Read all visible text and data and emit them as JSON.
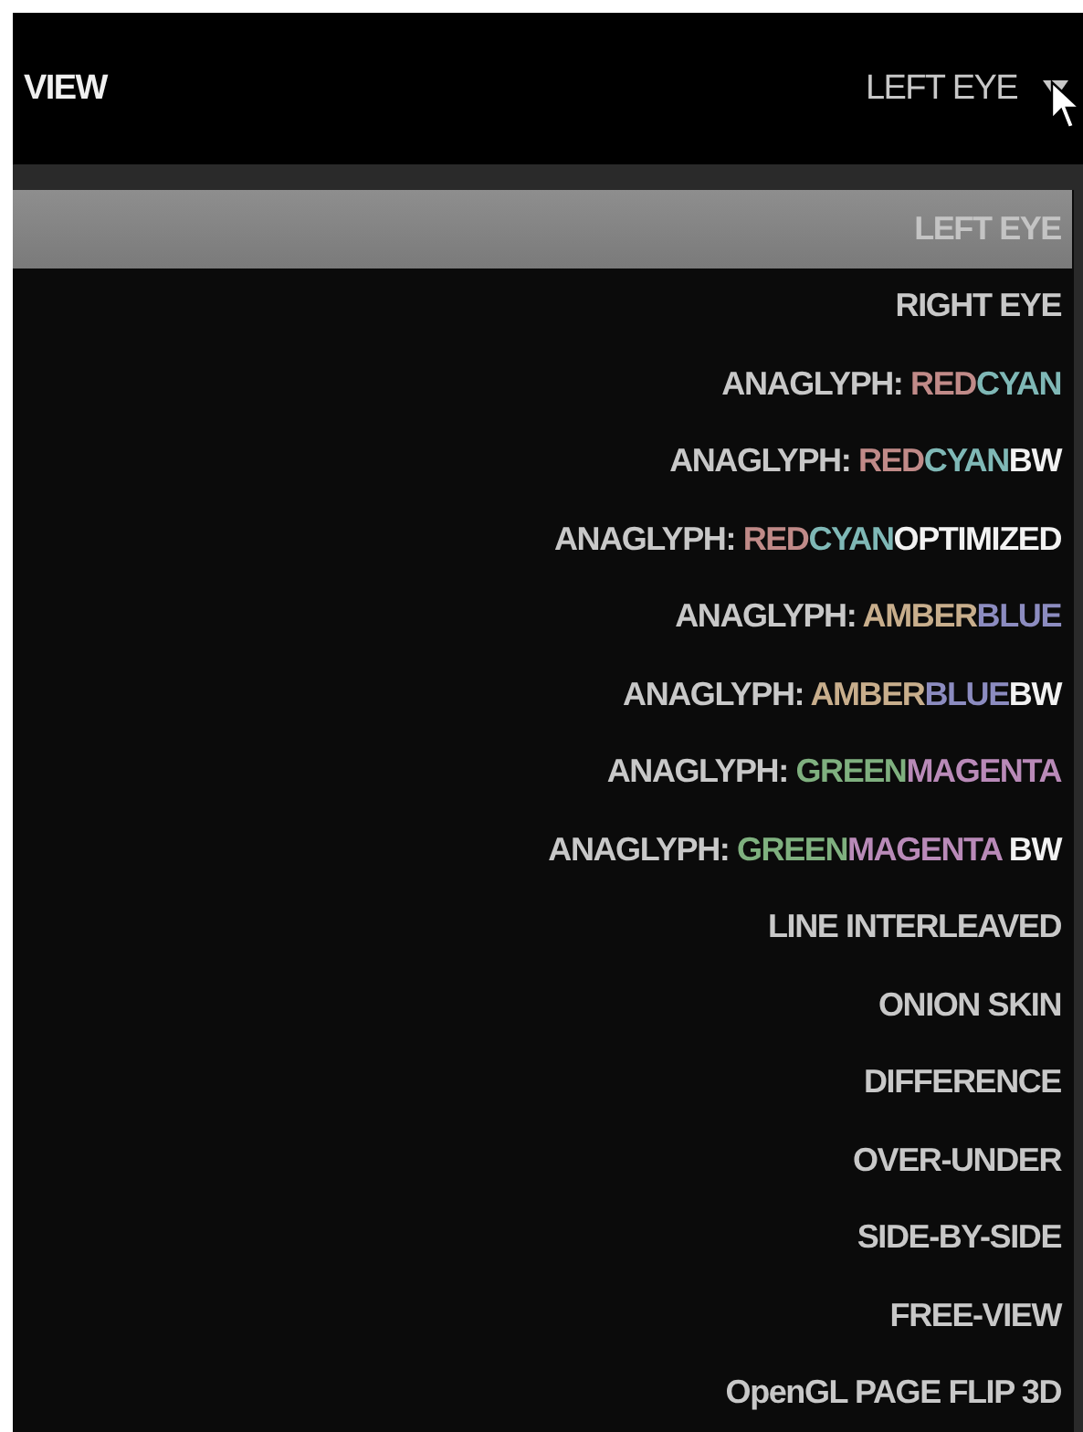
{
  "header": {
    "title": "VIEW",
    "dropdown": {
      "value": "LEFT EYE"
    }
  },
  "menu": {
    "items": [
      {
        "selected": true,
        "segments": [
          {
            "text": "LEFT EYE"
          }
        ]
      },
      {
        "selected": false,
        "segments": [
          {
            "text": "RIGHT EYE"
          }
        ]
      },
      {
        "selected": false,
        "segments": [
          {
            "text": "ANAGLYPH: "
          },
          {
            "text": "RED",
            "color": "#c08a88"
          },
          {
            "text": "CYAN",
            "color": "#7fb8b6"
          }
        ]
      },
      {
        "selected": false,
        "segments": [
          {
            "text": "ANAGLYPH: "
          },
          {
            "text": "RED",
            "color": "#c08a88"
          },
          {
            "text": "CYAN",
            "color": "#7fb8b6"
          },
          {
            "text": "BW",
            "color": "#f2f2f2"
          }
        ]
      },
      {
        "selected": false,
        "segments": [
          {
            "text": "ANAGLYPH: "
          },
          {
            "text": "RED",
            "color": "#c08a88"
          },
          {
            "text": "CYAN",
            "color": "#7fb8b6"
          },
          {
            "text": "OPTIMIZED",
            "color": "#f2f2f2"
          }
        ]
      },
      {
        "selected": false,
        "segments": [
          {
            "text": "ANAGLYPH: "
          },
          {
            "text": "AMBER",
            "color": "#c8ae8c"
          },
          {
            "text": "BLUE",
            "color": "#8c8cc0"
          }
        ]
      },
      {
        "selected": false,
        "segments": [
          {
            "text": "ANAGLYPH: "
          },
          {
            "text": "AMBER",
            "color": "#c8ae8c"
          },
          {
            "text": "BLUE",
            "color": "#8c8cc0"
          },
          {
            "text": "BW",
            "color": "#f2f2f2"
          }
        ]
      },
      {
        "selected": false,
        "segments": [
          {
            "text": "ANAGLYPH: "
          },
          {
            "text": "GREEN",
            "color": "#7fb07f"
          },
          {
            "text": "MAGENTA",
            "color": "#b98ab8"
          }
        ]
      },
      {
        "selected": false,
        "segments": [
          {
            "text": "ANAGLYPH: "
          },
          {
            "text": "GREEN",
            "color": "#7fb07f"
          },
          {
            "text": "MAGENTA",
            "color": "#b98ab8"
          },
          {
            "text": " BW",
            "color": "#f2f2f2"
          }
        ]
      },
      {
        "selected": false,
        "segments": [
          {
            "text": "LINE INTERLEAVED"
          }
        ]
      },
      {
        "selected": false,
        "segments": [
          {
            "text": "ONION SKIN"
          }
        ]
      },
      {
        "selected": false,
        "segments": [
          {
            "text": "DIFFERENCE"
          }
        ]
      },
      {
        "selected": false,
        "segments": [
          {
            "text": "OVER-UNDER"
          }
        ]
      },
      {
        "selected": false,
        "segments": [
          {
            "text": "SIDE-BY-SIDE"
          }
        ]
      },
      {
        "selected": false,
        "segments": [
          {
            "text": "FREE-VIEW"
          }
        ]
      },
      {
        "selected": false,
        "segments": [
          {
            "text": "OpenGL PAGE FLIP 3D"
          }
        ]
      }
    ]
  }
}
